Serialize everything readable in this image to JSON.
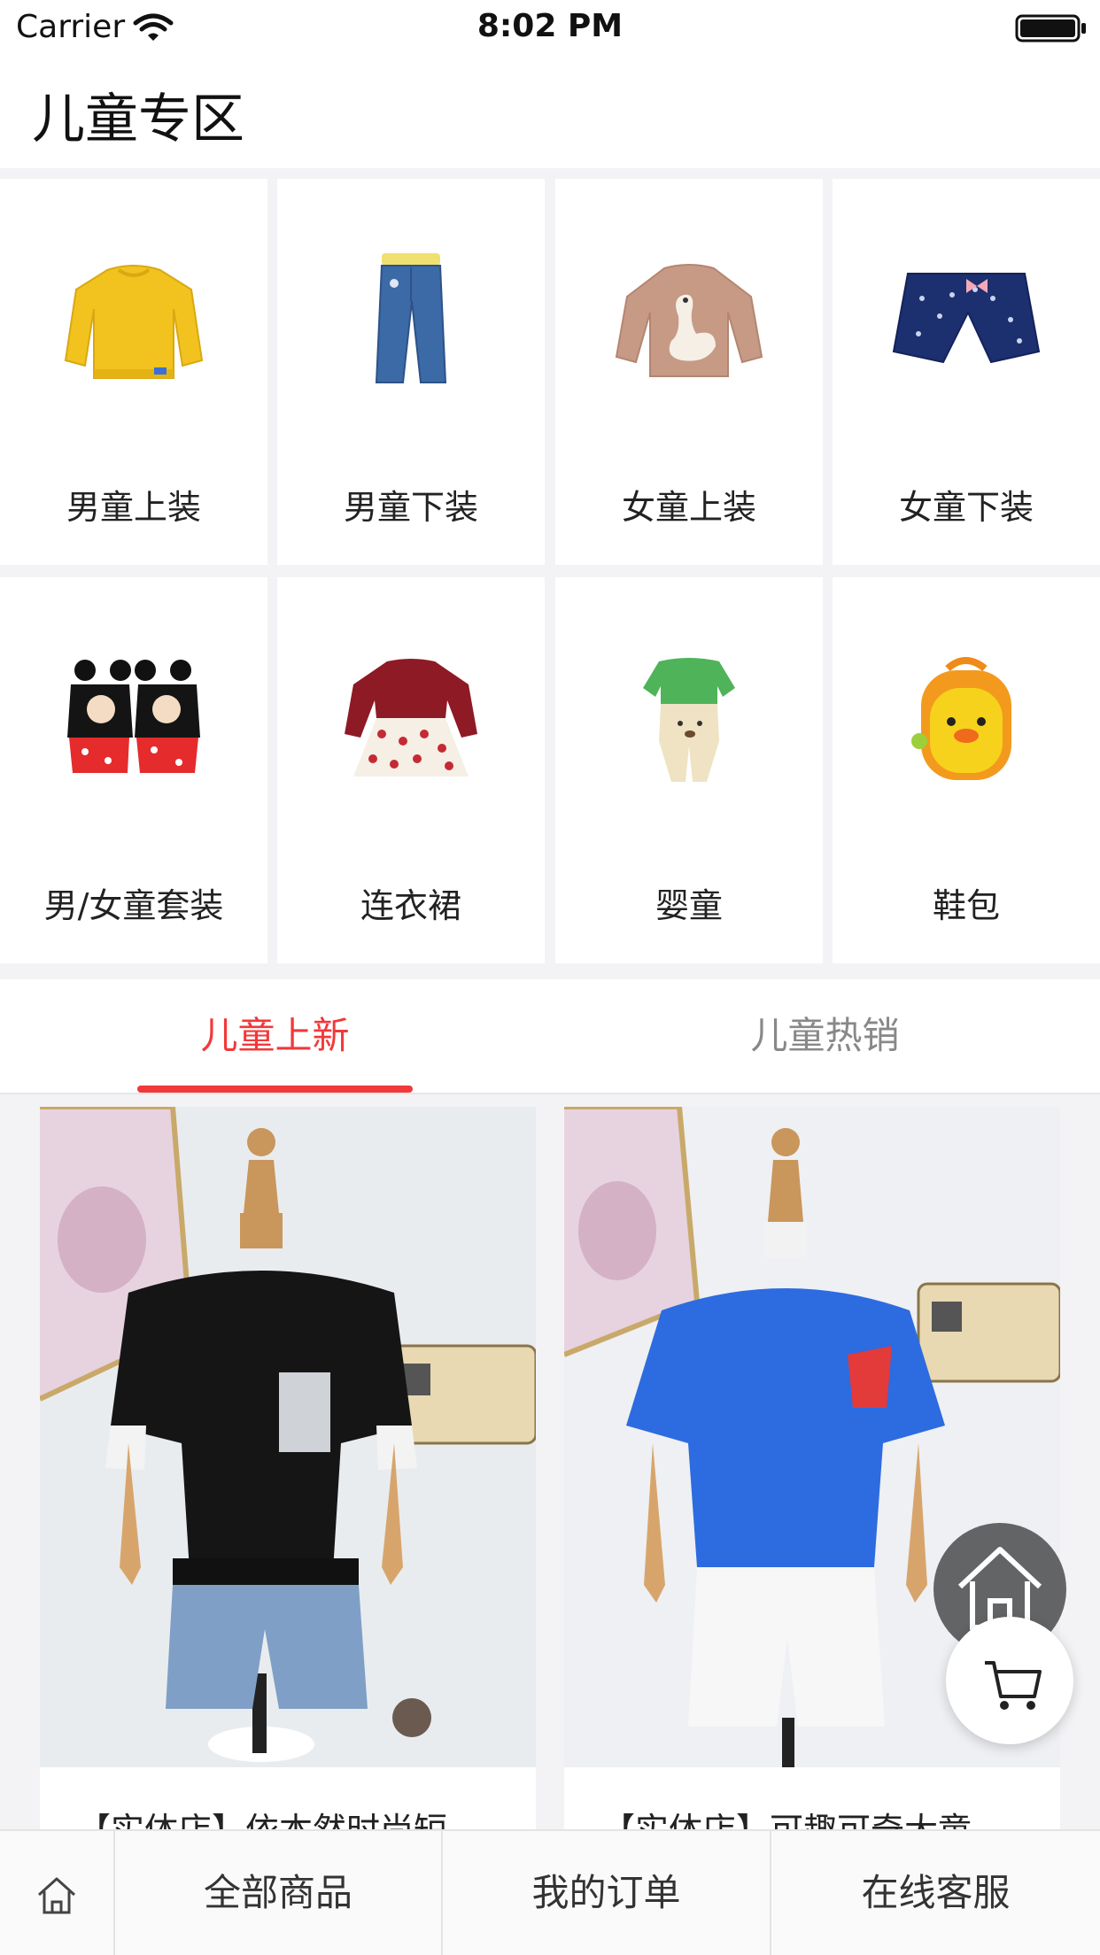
{
  "status_bar": {
    "carrier": "Carrier",
    "time": "8:02 PM"
  },
  "header": {
    "title": "儿童专区"
  },
  "categories": [
    {
      "label": "男童上装",
      "icon": "yellow-sweater-icon"
    },
    {
      "label": "男童下装",
      "icon": "jeans-icon"
    },
    {
      "label": "女童上装",
      "icon": "swan-top-icon"
    },
    {
      "label": "女童下装",
      "icon": "navy-shorts-icon"
    },
    {
      "label": "男/女童套装",
      "icon": "mickey-set-icon"
    },
    {
      "label": "连衣裙",
      "icon": "polka-dress-icon"
    },
    {
      "label": "婴童",
      "icon": "baby-romper-icon"
    },
    {
      "label": "鞋包",
      "icon": "duck-backpack-icon"
    }
  ],
  "tabs": [
    {
      "label": "儿童上新",
      "active": true
    },
    {
      "label": "儿童热销",
      "active": false
    }
  ],
  "products": [
    {
      "title": "【实体店】依本然时尚短",
      "image": "black-tshirt-mannequin-photo"
    },
    {
      "title": "【实体店】可趣可奇大童",
      "image": "blue-tshirt-mannequin-photo"
    }
  ],
  "bottom_bar": {
    "items": [
      {
        "label": "全部商品"
      },
      {
        "label": "我的订单"
      },
      {
        "label": "在线客服"
      }
    ]
  },
  "colors": {
    "accent": "#f2383a",
    "background": "#f3f3f6"
  }
}
